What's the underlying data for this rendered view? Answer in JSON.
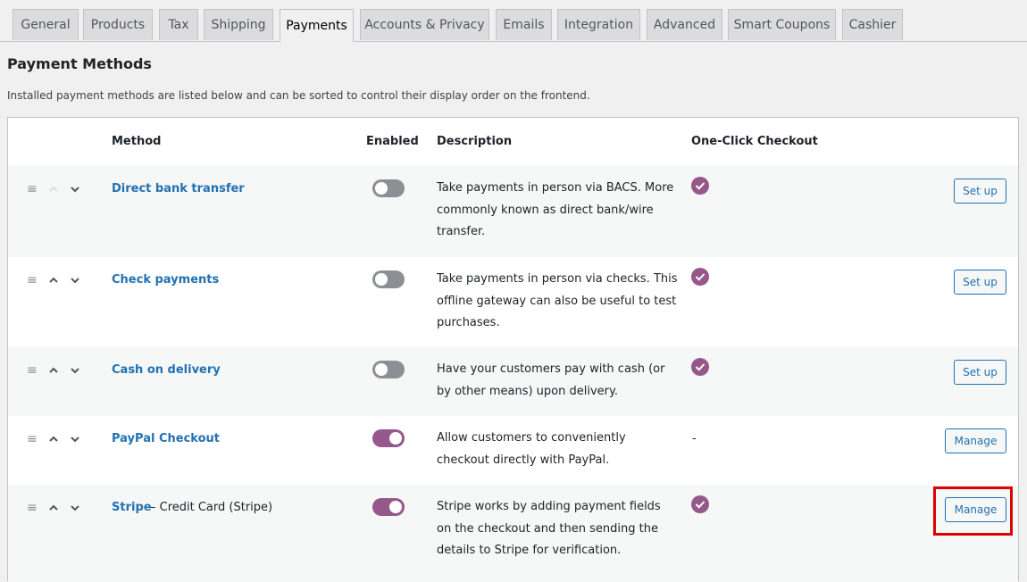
{
  "tabs": [
    {
      "label": "General",
      "active": false
    },
    {
      "label": "Products",
      "active": false
    },
    {
      "label": "Tax",
      "active": false
    },
    {
      "label": "Shipping",
      "active": false
    },
    {
      "label": "Payments",
      "active": true
    },
    {
      "label": "Accounts & Privacy",
      "active": false
    },
    {
      "label": "Emails",
      "active": false
    },
    {
      "label": "Integration",
      "active": false
    },
    {
      "label": "Advanced",
      "active": false
    },
    {
      "label": "Smart Coupons",
      "active": false
    },
    {
      "label": "Cashier",
      "active": false
    }
  ],
  "section": {
    "title": "Payment Methods",
    "description": "Installed payment methods are listed below and can be sorted to control their display order on the frontend."
  },
  "table": {
    "headers": {
      "method": "Method",
      "enabled": "Enabled",
      "description": "Description",
      "one_click": "One-Click Checkout"
    },
    "rows": [
      {
        "name": "Direct bank transfer",
        "suffix": "",
        "enabled": false,
        "description": "Take payments in person via BACS. More commonly known as direct bank/wire transfer.",
        "one_click": "check",
        "action": "Set up",
        "up_enabled": false
      },
      {
        "name": "Check payments",
        "suffix": "",
        "enabled": false,
        "description": "Take payments in person via checks. This offline gateway can also be useful to test purchases.",
        "one_click": "check",
        "action": "Set up",
        "up_enabled": true
      },
      {
        "name": "Cash on delivery",
        "suffix": "",
        "enabled": false,
        "description": "Have your customers pay with cash (or by other means) upon delivery.",
        "one_click": "check",
        "action": "Set up",
        "up_enabled": true
      },
      {
        "name": "PayPal Checkout",
        "suffix": "",
        "enabled": true,
        "description": "Allow customers to conveniently checkout directly with PayPal.",
        "one_click": "-",
        "action": "Manage",
        "up_enabled": true
      },
      {
        "name": "Stripe",
        "suffix": "– Credit Card (Stripe)",
        "enabled": true,
        "description": "Stripe works by adding payment fields on the checkout and then sending the details to Stripe for verification.",
        "one_click": "check",
        "action": "Manage",
        "up_enabled": true
      }
    ]
  },
  "colors": {
    "accent": "#2271b1",
    "toggle_on": "#96588a",
    "toggle_off": "#8c8f94",
    "check": "#96588a",
    "highlight": "#e00000"
  },
  "icons": {
    "drag": "menu-handle-icon",
    "up": "chevron-up-icon",
    "down": "chevron-down-icon",
    "check": "check-circle-icon"
  }
}
